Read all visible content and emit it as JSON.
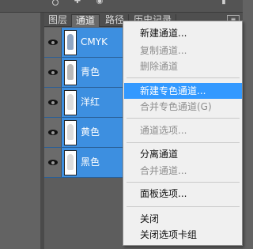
{
  "tabs": [
    {
      "label": "图层",
      "active": false
    },
    {
      "label": "通道",
      "active": true
    },
    {
      "label": "路径",
      "active": false
    },
    {
      "label": "历史记录",
      "active": false
    }
  ],
  "channels": [
    {
      "label": "CMYK"
    },
    {
      "label": "青色"
    },
    {
      "label": "洋红"
    },
    {
      "label": "黄色"
    },
    {
      "label": "黑色"
    }
  ],
  "menu": {
    "items": [
      {
        "label": "新建通道...",
        "disabled": false,
        "highlighted": false
      },
      {
        "label": "复制通道...",
        "disabled": true,
        "highlighted": false
      },
      {
        "label": "删除通道",
        "disabled": true,
        "highlighted": false
      },
      {
        "label": "新建专色通道...",
        "disabled": false,
        "highlighted": true
      },
      {
        "label": "合并专色通道(G)",
        "disabled": true,
        "highlighted": false
      },
      {
        "label": "通道选项...",
        "disabled": true,
        "highlighted": false
      },
      {
        "label": "分离通道",
        "disabled": false,
        "highlighted": false
      },
      {
        "label": "合并通道...",
        "disabled": true,
        "highlighted": false
      },
      {
        "label": "面板选项...",
        "disabled": false,
        "highlighted": false
      },
      {
        "label": "关闭",
        "disabled": false,
        "highlighted": false
      },
      {
        "label": "关闭选项卡组",
        "disabled": false,
        "highlighted": false
      }
    ]
  },
  "colors": {
    "selection": "#3d8fe0",
    "menu_highlight": "#3399ff",
    "menu_bg": "#f0f0f0",
    "panel_bg": "#5d5d5d"
  }
}
